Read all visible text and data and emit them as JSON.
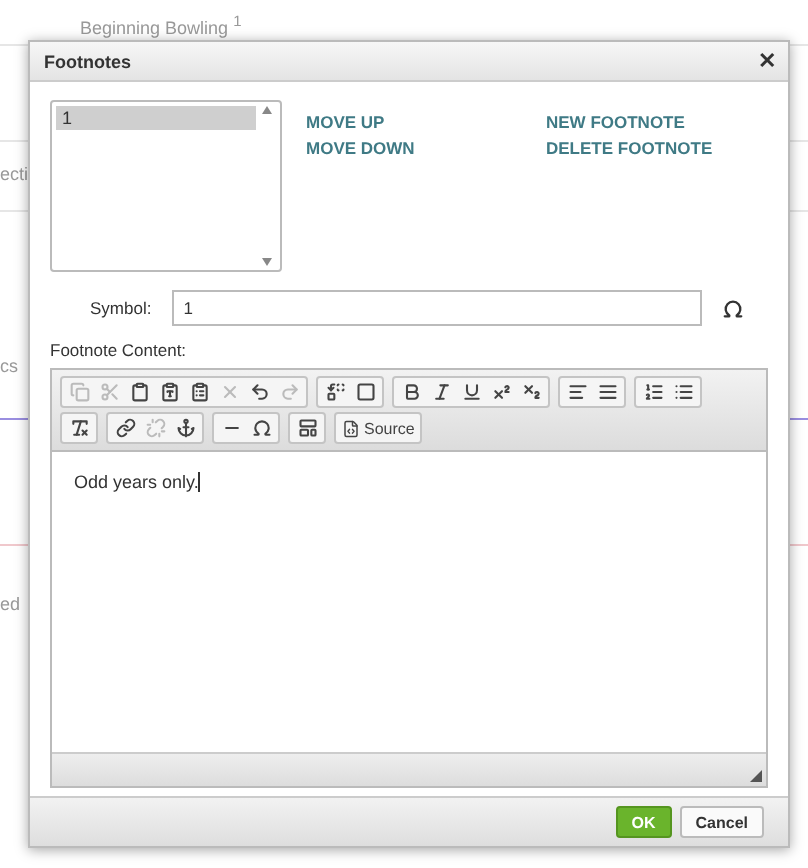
{
  "background": {
    "heading": "Beginning Bowling",
    "heading_mark": "1",
    "fragments": [
      "ecti",
      "cs",
      "ed"
    ]
  },
  "dialog": {
    "title": "Footnotes",
    "close": "✕",
    "footnotes": [
      {
        "label": "1",
        "selected": true
      }
    ],
    "actions": [
      [
        "MOVE UP",
        "MOVE DOWN"
      ],
      [
        "NEW FOOTNOTE",
        "DELETE FOOTNOTE"
      ]
    ],
    "symbol_label": "Symbol:",
    "symbol_value": "1",
    "content_label": "Footnote Content:",
    "toolbar": [
      [
        [
          {
            "kind": "copy",
            "disabled": true
          },
          {
            "kind": "cut",
            "disabled": true
          },
          {
            "kind": "paste",
            "disabled": false
          },
          {
            "kind": "paste-text",
            "disabled": false
          },
          {
            "kind": "paste-word",
            "disabled": false
          },
          {
            "kind": "remove",
            "disabled": true
          },
          {
            "kind": "undo",
            "disabled": false
          },
          {
            "kind": "redo",
            "disabled": true
          }
        ],
        [
          {
            "kind": "replace",
            "disabled": false
          },
          {
            "kind": "select-all",
            "disabled": false
          }
        ],
        [
          {
            "kind": "bold",
            "disabled": false
          },
          {
            "kind": "italic",
            "disabled": false
          },
          {
            "kind": "underline",
            "disabled": false
          },
          {
            "kind": "superscript",
            "disabled": false
          },
          {
            "kind": "subscript",
            "disabled": false
          }
        ],
        [
          {
            "kind": "align-left",
            "disabled": false
          },
          {
            "kind": "justify",
            "disabled": false
          }
        ],
        [
          {
            "kind": "numbered-list",
            "disabled": false
          },
          {
            "kind": "bulleted-list",
            "disabled": false
          }
        ]
      ],
      [
        [
          {
            "kind": "clear-format",
            "disabled": false
          }
        ],
        [
          {
            "kind": "link",
            "disabled": false
          },
          {
            "kind": "unlink",
            "disabled": true
          },
          {
            "kind": "anchor",
            "disabled": false
          }
        ],
        [
          {
            "kind": "rule",
            "disabled": false
          },
          {
            "kind": "omega",
            "disabled": false
          }
        ],
        [
          {
            "kind": "template",
            "disabled": false
          }
        ],
        [
          {
            "kind": "source",
            "label": "Source",
            "disabled": false
          }
        ]
      ]
    ],
    "content": "Odd years only.",
    "buttons": [
      {
        "label": "OK",
        "kind": "primary"
      },
      {
        "label": "Cancel",
        "kind": "secondary"
      }
    ]
  }
}
